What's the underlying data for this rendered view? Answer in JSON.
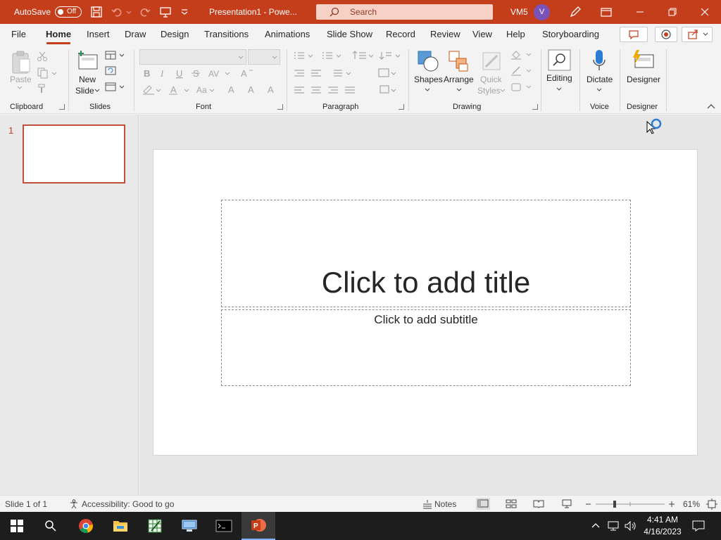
{
  "titlebar": {
    "autosave_label": "AutoSave",
    "autosave_state": "Off",
    "doc_title": "Presentation1 - Powe...",
    "search_placeholder": "Search",
    "user_name": "VM5",
    "avatar_initial": "V",
    "accent": "#c43e1c"
  },
  "tabs": [
    "File",
    "Home",
    "Insert",
    "Draw",
    "Design",
    "Transitions",
    "Animations",
    "Slide Show",
    "Record",
    "Review",
    "View",
    "Help",
    "Storyboarding"
  ],
  "active_tab": "Home",
  "ribbon": {
    "clipboard": {
      "paste": "Paste",
      "label": "Clipboard"
    },
    "slides": {
      "new_slide_1": "New",
      "new_slide_2": "Slide",
      "label": "Slides"
    },
    "font": {
      "label": "Font"
    },
    "paragraph": {
      "label": "Paragraph"
    },
    "drawing": {
      "shapes": "Shapes",
      "arrange": "Arrange",
      "quick_styles_1": "Quick",
      "quick_styles_2": "Styles",
      "label": "Drawing"
    },
    "editing": {
      "label": "Editing"
    },
    "voice": {
      "dictate": "Dictate",
      "label": "Voice"
    },
    "designer": {
      "designer": "Designer",
      "label": "Designer"
    }
  },
  "thumbnails": [
    {
      "number": "1"
    }
  ],
  "slide": {
    "title_placeholder": "Click to add title",
    "subtitle_placeholder": "Click to add subtitle"
  },
  "statusbar": {
    "slide_info": "Slide 1 of 1",
    "accessibility": "Accessibility: Good to go",
    "notes": "Notes",
    "zoom": "61%"
  },
  "taskbar": {
    "time": "4:41 AM",
    "date": "4/16/2023"
  }
}
